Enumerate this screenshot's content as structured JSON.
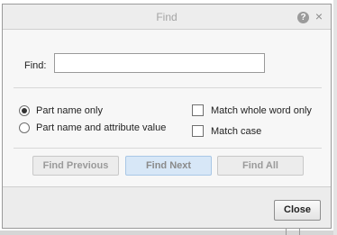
{
  "dialog": {
    "title": "Find",
    "help_icon": "?",
    "close_icon": "×"
  },
  "find": {
    "label": "Find:",
    "value": "",
    "placeholder": ""
  },
  "options": {
    "match_mode_selected": "Part name only",
    "part_name_only": "Part name only",
    "part_name_and_attribute": "Part name and attribute value",
    "match_whole_word": "Match whole word only",
    "match_whole_word_checked": false,
    "match_case": "Match case",
    "match_case_checked": false
  },
  "buttons": {
    "find_previous": "Find Previous",
    "find_next": "Find Next",
    "find_all": "Find All",
    "close": "Close"
  },
  "colors": {
    "accent_button": "#d7e7f7",
    "dialog_bg": "#f0f0f0"
  }
}
